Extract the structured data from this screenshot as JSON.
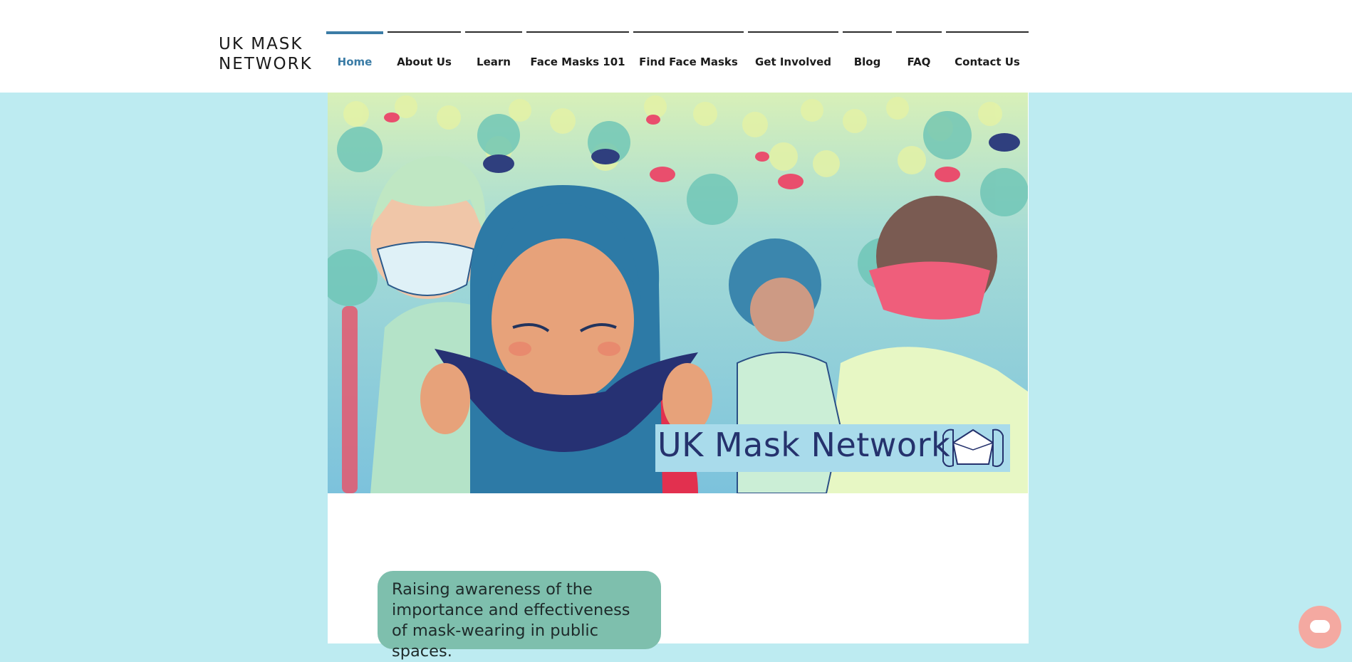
{
  "logo": {
    "line1": "UK MASK",
    "line2": "NETWORK"
  },
  "nav": {
    "items": [
      {
        "label": "Home",
        "active": true
      },
      {
        "label": "About Us",
        "active": false
      },
      {
        "label": "Learn",
        "active": false
      },
      {
        "label": "Face Masks 101",
        "active": false
      },
      {
        "label": "Find Face Masks",
        "active": false
      },
      {
        "label": "Get Involved",
        "active": false
      },
      {
        "label": "Blog",
        "active": false
      },
      {
        "label": "FAQ",
        "active": false
      },
      {
        "label": "Contact Us",
        "active": false
      }
    ]
  },
  "hero": {
    "title": "UK Mask Network",
    "icon": "face-mask-icon"
  },
  "tagline": "Raising awareness of the importance and effectiveness of mask-wearing in public spaces.",
  "chat": {
    "icon": "chat-bubble-icon"
  },
  "colors": {
    "page_background": "#bdebf1",
    "accent": "#3b7ca6",
    "tagline_background": "#7ebfad",
    "chat_button": "#f4a9a1",
    "hero_title_text": "#25326d"
  }
}
